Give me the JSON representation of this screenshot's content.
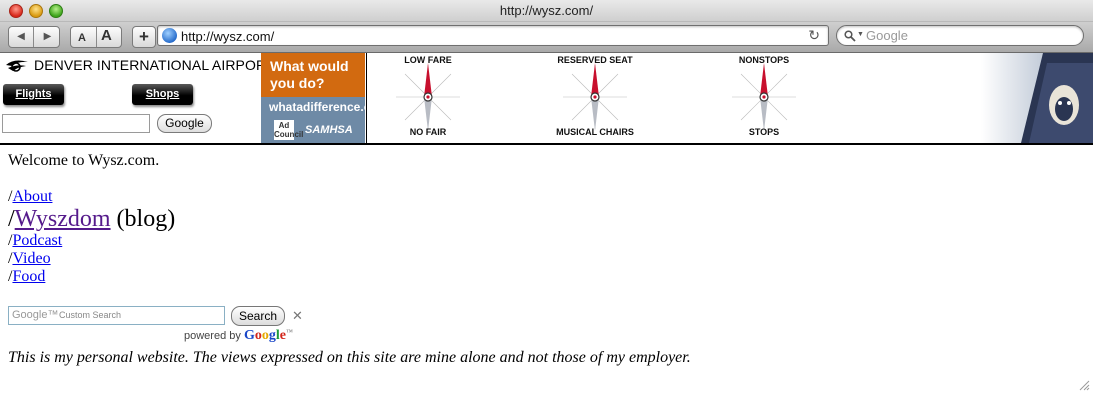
{
  "window": {
    "title": "http://wysz.com/"
  },
  "toolbar": {
    "back_icon": "◀",
    "forward_icon": "▶",
    "text_smaller": "A",
    "text_bigger": "A",
    "add_bookmark": "+",
    "url": "http://wysz.com/",
    "reload_icon": "↻",
    "search_placeholder": "Google",
    "search_icon": "🔍"
  },
  "header": {
    "airport_name": "DENVER INTERNATIONAL AIRPORT",
    "flights_label": "Flights",
    "shops_label": "Shops",
    "google_button": "Google"
  },
  "ad_left": {
    "question": "What would you do?",
    "url": "whatadifference.o",
    "council_mark": "Ad Council",
    "samhsa": "SAMHSA"
  },
  "ad_airline": {
    "compasses": [
      {
        "top": "LOW FARE",
        "bottom": "NO FAIR"
      },
      {
        "top": "RESERVED SEAT",
        "bottom": "MUSICAL CHAIRS"
      },
      {
        "top": "NONSTOPS",
        "bottom": "STOPS"
      }
    ]
  },
  "page": {
    "welcome": "Welcome to Wysz.com.",
    "nav": [
      {
        "prefix": "/",
        "label": "About",
        "suffix": ""
      },
      {
        "prefix": "/",
        "label": "Wyszdom",
        "suffix": " (blog)"
      },
      {
        "prefix": "/",
        "label": "Podcast",
        "suffix": ""
      },
      {
        "prefix": "/",
        "label": "Video",
        "suffix": ""
      },
      {
        "prefix": "/",
        "label": "Food",
        "suffix": ""
      }
    ],
    "search": {
      "google_watermark": "Google™",
      "placeholder": "Custom Search",
      "button": "Search",
      "clear_icon": "✕",
      "powered_by": "powered by"
    },
    "disclaimer": "This is my personal website. The views expressed on this site are mine alone and not those of my employer."
  },
  "colors": {
    "link": "#0000ee",
    "visited_link": "#551a8b",
    "ad_orange": "#d26a10"
  }
}
